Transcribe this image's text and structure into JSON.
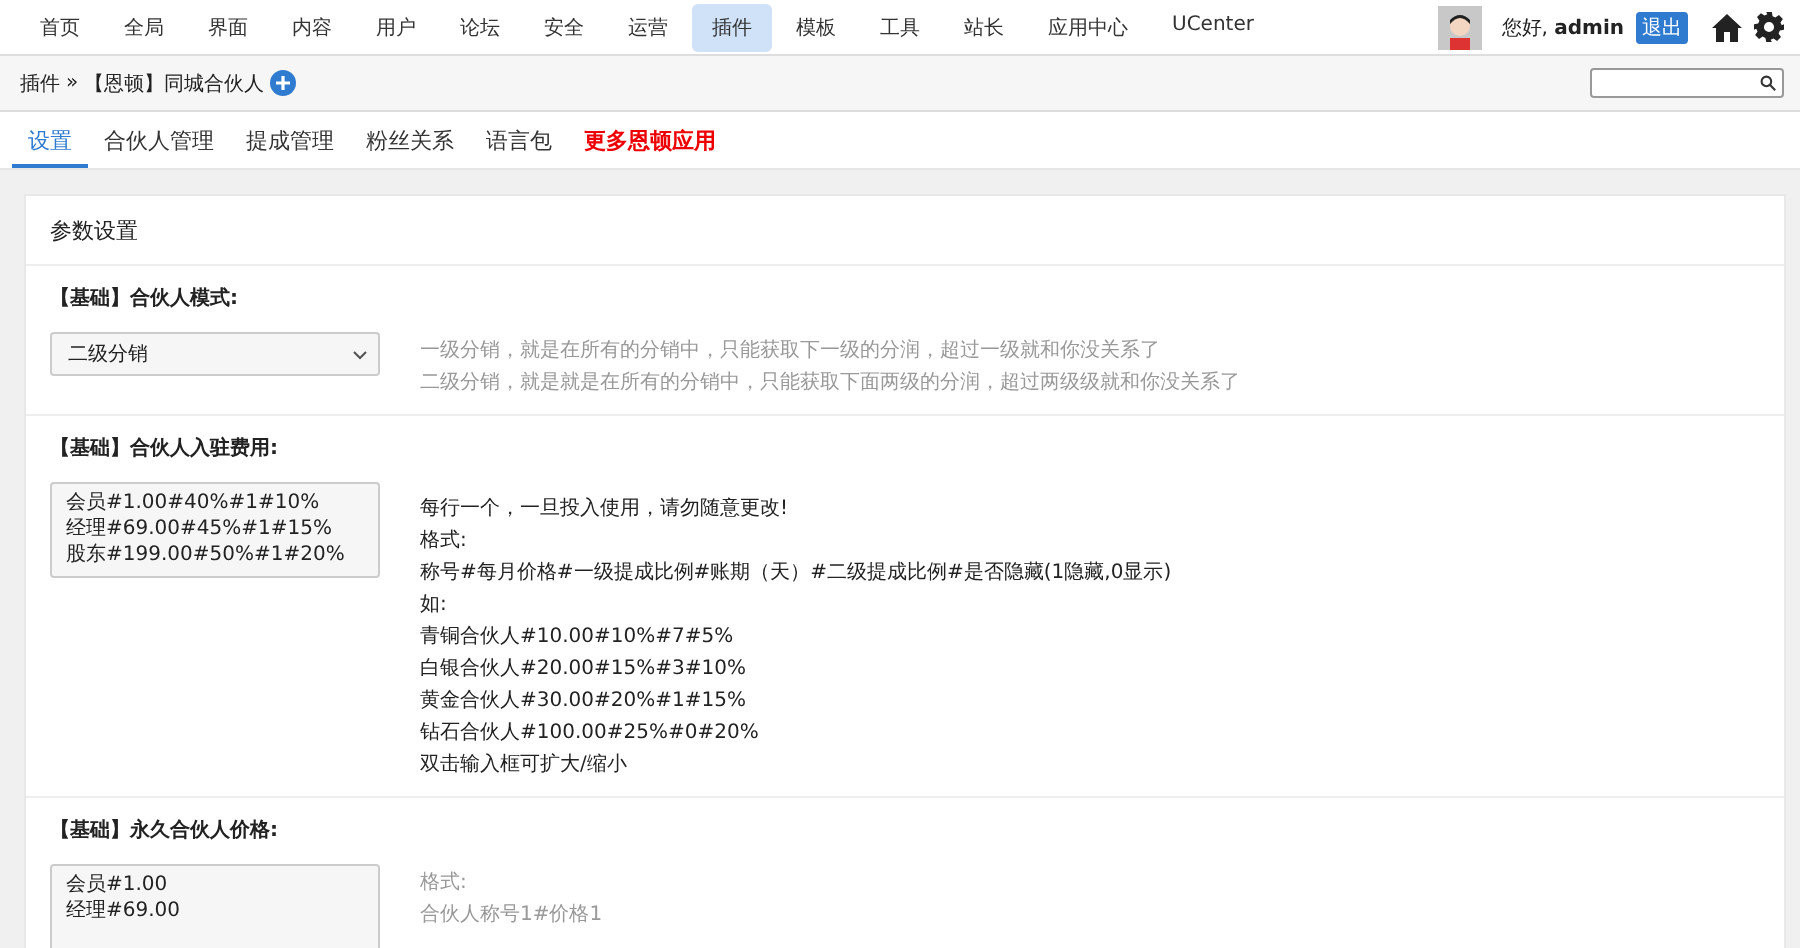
{
  "nav": {
    "items": [
      {
        "label": "首页",
        "selected": false
      },
      {
        "label": "全局",
        "selected": false
      },
      {
        "label": "界面",
        "selected": false
      },
      {
        "label": "内容",
        "selected": false
      },
      {
        "label": "用户",
        "selected": false
      },
      {
        "label": "论坛",
        "selected": false
      },
      {
        "label": "安全",
        "selected": false
      },
      {
        "label": "运营",
        "selected": false
      },
      {
        "label": "插件",
        "selected": true
      },
      {
        "label": "模板",
        "selected": false
      },
      {
        "label": "工具",
        "selected": false
      },
      {
        "label": "站长",
        "selected": false
      },
      {
        "label": "应用中心",
        "selected": false
      },
      {
        "label": "UCenter",
        "selected": false
      }
    ],
    "greeting": "您好, **admin**",
    "logout": "退出"
  },
  "breadcrumb": {
    "parent": "插件",
    "separator": "»",
    "current": "【恩顿】同城合伙人"
  },
  "tabs": [
    {
      "label": "设置",
      "selected": true,
      "kind": "normal"
    },
    {
      "label": "合伙人管理",
      "selected": false,
      "kind": "normal"
    },
    {
      "label": "提成管理",
      "selected": false,
      "kind": "normal"
    },
    {
      "label": "粉丝关系",
      "selected": false,
      "kind": "normal"
    },
    {
      "label": "语言包",
      "selected": false,
      "kind": "normal"
    },
    {
      "label": "更多恩顿应用",
      "selected": false,
      "kind": "promo"
    }
  ],
  "panel": {
    "title": "参数设置",
    "sections": [
      {
        "label": "【基础】合伙人模式:",
        "control": {
          "kind": "select",
          "value": "二级分销"
        },
        "muted": true,
        "help": [
          "一级分销，就是在所有的分销中，只能获取下一级的分润，超过一级就和你没关系了",
          "二级分销，就是就是在所有的分销中，只能获取下面两级的分润，超过两级级就和你没关系了"
        ]
      },
      {
        "label": "【基础】合伙人入驻费用:",
        "control": {
          "kind": "textarea",
          "lines": [
            "会员#1.00#40%#1#10%",
            "经理#69.00#45%#1#15%",
            "股东#199.00#50%#1#20%"
          ]
        },
        "muted": false,
        "help": [
          "每行一个，一旦投入使用，请勿随意更改!",
          "格式:",
          "称号#每月价格#一级提成比例#账期（天）#二级提成比例#是否隐藏(1隐藏,0显示)",
          "如:",
          "青铜合伙人#10.00#10%#7#5%",
          "白银合伙人#20.00#15%#3#10%",
          "黄金合伙人#30.00#20%#1#15%",
          "钻石合伙人#100.00#25%#0#20%",
          "双击输入框可扩大/缩小"
        ]
      },
      {
        "label": "【基础】永久合伙人价格:",
        "control": {
          "kind": "textarea",
          "lines": [
            "会员#1.00",
            "经理#69.00"
          ]
        },
        "muted": true,
        "help": [
          "格式:",
          "合伙人称号1#价格1"
        ]
      }
    ]
  }
}
